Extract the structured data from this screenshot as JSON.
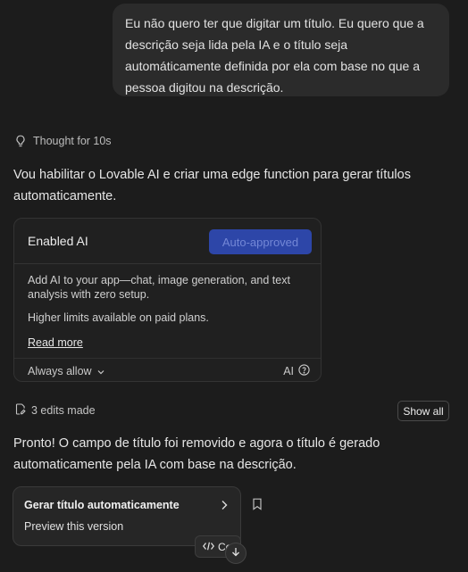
{
  "user_message": {
    "text": "Eu não quero ter que digitar um título. Eu quero que a descrição seja lida pela IA e o título seja automáticamente definida por ela com base no que a pessoa digitou na descrição."
  },
  "thought": {
    "icon": "lightbulb-icon",
    "label": "Thought for 10s"
  },
  "reply_1": "Vou habilitar o Lovable AI e criar uma edge function para gerar títulos automaticamente.",
  "ai_card": {
    "title": "Enabled AI",
    "status_button": "Auto-approved",
    "description": "Add AI to your app—chat, image generation, and text analysis with zero setup.",
    "limits_note": "Higher limits available on paid plans.",
    "read_more": "Read more",
    "permission": "Always allow",
    "ai_label": "AI",
    "accent_color": "#2d46a8"
  },
  "edits": {
    "icon": "file-edit-icon",
    "label": "3 edits made",
    "show_all": "Show all"
  },
  "reply_2": "Pronto! O campo de título foi removido e agora o título é gerado automaticamente pela IA com base na descrição.",
  "version_card": {
    "title": "Gerar título automaticamente",
    "subtitle": "Preview this version"
  },
  "code_pill": {
    "label": "Cc"
  }
}
